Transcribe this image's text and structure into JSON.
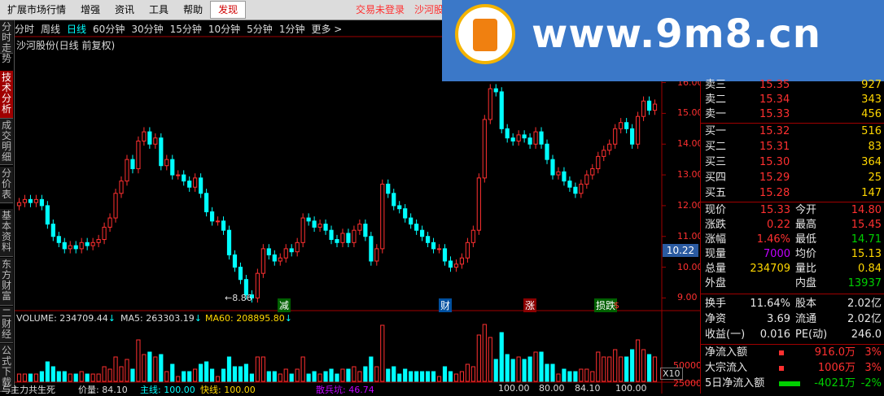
{
  "menubar": {
    "items": [
      "扩展市场行情",
      "增强",
      "资讯",
      "工具",
      "帮助",
      "发现"
    ],
    "active_index": 5,
    "trade_status": "交易未登录",
    "stock_short": "沙河股"
  },
  "side_tabs": [
    "分时走势",
    "技术分析",
    "成交明细",
    "分价表",
    "基本资料",
    "东方财富",
    "二财经",
    "公式下载"
  ],
  "period_bar": [
    "分时",
    "周线",
    "日线",
    "60分钟",
    "30分钟",
    "15分钟",
    "10分钟",
    "5分钟",
    "1分钟",
    "更多 >"
  ],
  "period_active_index": 2,
  "chart_title": "沙河股份(日线 前复权)",
  "watermark": {
    "text": "www.9m8.cn"
  },
  "price_axis": {
    "labels": [
      "16.00",
      "15.00",
      "14.00",
      "13.00",
      "12.00",
      "11.00",
      "10.00",
      "9.00"
    ],
    "current_badge": "10.22"
  },
  "annotations": {
    "low_price": "8.86",
    "markers": [
      "减",
      "财",
      "涨",
      "损跌",
      "$"
    ]
  },
  "volume_axis": {
    "labels": [
      "50000",
      "25000",
      "X10"
    ]
  },
  "volume_header": {
    "volume": "VOLUME: 234709.44",
    "ma5": "MA5: 263303.19",
    "ma60": "MA60: 208895.80"
  },
  "bottom_indicator": {
    "name": "与主力共生死",
    "price": "价量: 84.10",
    "main": "主线: 100.00",
    "fast": "快线: 100.00",
    "retail": "散兵坑: 46.74",
    "tail1": "100.00",
    "tail2": "80.00",
    "tail3": "84.10",
    "tail4": "100.00"
  },
  "order_book": {
    "sells": [
      {
        "label": "卖三",
        "price": "15.35",
        "vol": "927"
      },
      {
        "label": "卖二",
        "price": "15.34",
        "vol": "343"
      },
      {
        "label": "卖一",
        "price": "15.33",
        "vol": "456"
      }
    ],
    "buys": [
      {
        "label": "买一",
        "price": "15.32",
        "vol": "516"
      },
      {
        "label": "买二",
        "price": "15.31",
        "vol": "83"
      },
      {
        "label": "买三",
        "price": "15.30",
        "vol": "364"
      },
      {
        "label": "买四",
        "price": "15.29",
        "vol": "25"
      },
      {
        "label": "买五",
        "price": "15.28",
        "vol": "147"
      }
    ]
  },
  "stats": {
    "现价": "15.33",
    "今开": "14.80",
    "涨跌": "0.22",
    "最高": "15.45",
    "涨幅": "1.46%",
    "最低": "14.71",
    "现量": "7000",
    "均价": "15.13",
    "总量": "234709",
    "量比": "0.84",
    "外盘": "",
    "内盘": "13937"
  },
  "fundamentals": {
    "换手": "11.64%",
    "股本": "2.02亿",
    "净资": "3.69",
    "流通": "2.02亿",
    "收益(一)": "0.016",
    "PE(动)": "246.0"
  },
  "flows": [
    {
      "label": "净流入额",
      "value": "916.0万",
      "pct": "3%",
      "color": "red"
    },
    {
      "label": "大宗流入",
      "value": "1006万",
      "pct": "3%",
      "color": "red"
    },
    {
      "label": "5日净流入额",
      "value": "-4021万",
      "pct": "-2%",
      "color": "green"
    }
  ],
  "chart_data": {
    "type": "candlestick",
    "title": "沙河股份(日线 前复权)",
    "ylim": [
      8.8,
      16.2
    ],
    "closes": [
      12.1,
      12.2,
      12.1,
      12.2,
      12.0,
      11.4,
      11.0,
      10.8,
      10.6,
      10.7,
      10.6,
      10.8,
      10.7,
      10.8,
      10.9,
      11.3,
      11.6,
      12.4,
      12.8,
      13.5,
      13.2,
      14.1,
      14.4,
      14.0,
      14.2,
      13.3,
      13.5,
      13.0,
      13.0,
      12.8,
      12.6,
      12.9,
      12.4,
      11.8,
      11.5,
      11.5,
      11.2,
      10.4,
      10.0,
      9.6,
      9.1,
      9.0,
      9.8,
      10.6,
      10.4,
      10.2,
      10.3,
      10.6,
      10.5,
      10.8,
      11.6,
      11.5,
      11.3,
      11.4,
      11.2,
      10.9,
      10.8,
      11.1,
      10.8,
      11.2,
      11.4,
      11.0,
      10.2,
      10.6,
      12.7,
      12.4,
      12.0,
      11.9,
      11.6,
      11.4,
      11.2,
      11.0,
      10.8,
      10.6,
      10.6,
      10.2,
      10.0,
      10.1,
      10.3,
      10.8,
      11.2,
      12.9,
      14.8,
      15.8,
      15.7,
      14.5,
      14.2,
      14.1,
      14.3,
      14.2,
      14.0,
      14.4,
      14.0,
      13.5,
      13.0,
      13.1,
      12.8,
      12.6,
      12.4,
      12.7,
      13.0,
      13.2,
      13.6,
      13.8,
      14.0,
      14.5,
      14.7,
      14.5,
      14.0,
      14.9,
      15.4,
      15.1,
      15.3
    ]
  }
}
